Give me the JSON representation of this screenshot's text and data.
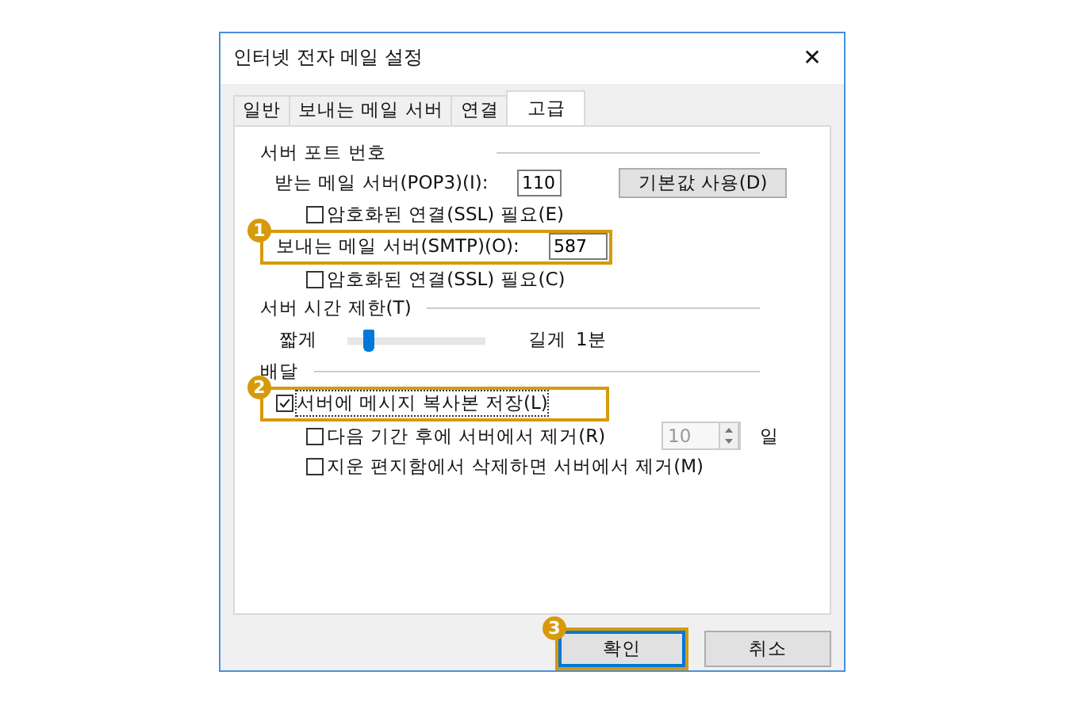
{
  "window": {
    "title": "인터넷 전자 메일 설정",
    "close": "✕"
  },
  "tabs": [
    {
      "label": "일반",
      "selected": false
    },
    {
      "label": "보내는 메일 서버",
      "selected": false
    },
    {
      "label": "연결",
      "selected": false
    },
    {
      "label": "고급",
      "selected": true
    }
  ],
  "server_ports": {
    "heading": "서버 포트 번호",
    "incoming": {
      "label": "받는 메일 서버(POP3)(I):",
      "value": "110"
    },
    "default_button": "기본값 사용(D)",
    "incoming_ssl": {
      "label": "암호화된 연결(SSL) 필요(E)",
      "checked": false
    },
    "outgoing": {
      "label": "보내는 메일 서버(SMTP)(O):",
      "value": "587",
      "callout": "1"
    },
    "outgoing_ssl": {
      "label": "암호화된 연결(SSL) 필요(C)",
      "checked": false
    }
  },
  "timeout": {
    "heading": "서버 시간 제한(T)",
    "short": "짧게",
    "long": "길게",
    "level": 0.1,
    "reading": "1분"
  },
  "delivery": {
    "heading": "배달",
    "leave_copy": {
      "label": "서버에 메시지 복사본 저장(L)",
      "checked": true,
      "callout": "2"
    },
    "remove_after": {
      "label": "다음 기간 후에 서버에서 제거(R)",
      "checked": false,
      "value": "10",
      "disabled": true,
      "unit": "일"
    },
    "remove_deleted": {
      "label": "지운 편지함에서 삭제하면 서버에서 제거(M)",
      "checked": false
    }
  },
  "buttons": [
    {
      "label": "확인",
      "default": true,
      "callout": "3"
    },
    {
      "label": "취소",
      "default": false
    }
  ]
}
